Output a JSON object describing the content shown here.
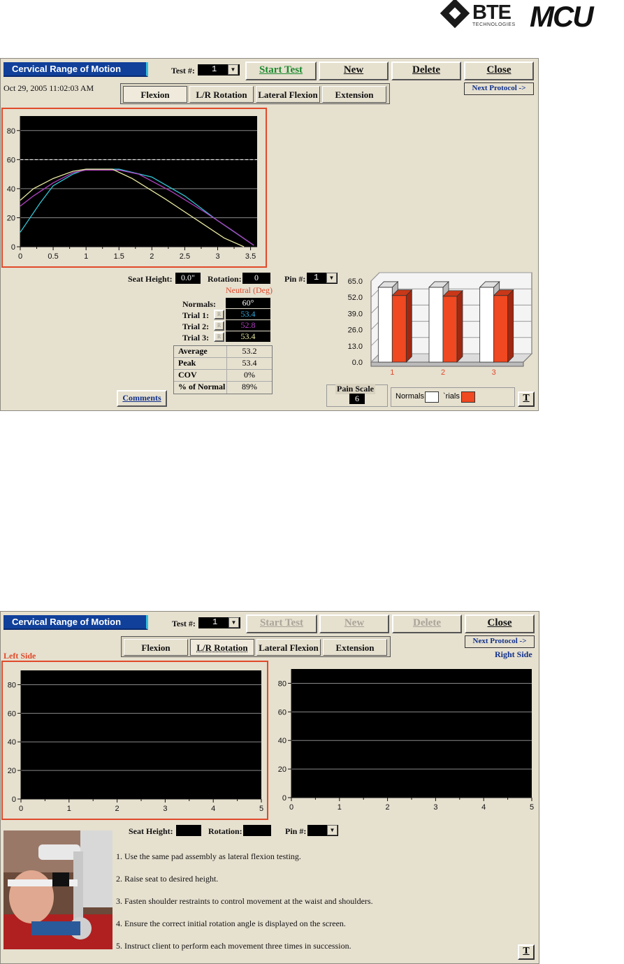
{
  "header": {
    "bte_brand": "BTE",
    "bte_sub": "TECHNOLOGIES",
    "mcu_brand": "MCU"
  },
  "colors": {
    "title_bg": "#10409a",
    "accent_red": "#e04a2a",
    "panel": "#e6e0cf",
    "plot_bg": "#000000"
  },
  "panel1": {
    "title": "Cervical Range of Motion",
    "test_label": "Test #:",
    "test_value": "1",
    "start_test": "Start Test",
    "new": "New",
    "delete": "Delete",
    "close": "Close",
    "timestamp": "Oct 29, 2005 11:02:03 AM",
    "tabs": [
      "Flexion",
      "L/R Rotation",
      "Lateral Flexion",
      "Extension"
    ],
    "next_protocol": "Next Protocol ->",
    "seat_height_label": "Seat Height:",
    "seat_height_value": "0.0\"",
    "rotation_label": "Rotation:",
    "rotation_value": "0",
    "neutral_label": "Neutral (Deg)",
    "pin_label": "Pin #:",
    "pin_value": "1",
    "normals_label": "Normals:",
    "normals_value": "60°",
    "trials": [
      {
        "label": "Trial 1:",
        "value": "53.4",
        "color": "#30a8d8"
      },
      {
        "label": "Trial 2:",
        "value": "52.8",
        "color": "#b040c0"
      },
      {
        "label": "Trial 3:",
        "value": "53.4",
        "color": "#e8e8a0"
      }
    ],
    "r_button": "R",
    "stats": [
      {
        "label": "Average",
        "value": "53.2"
      },
      {
        "label": "Peak",
        "value": "53.4"
      },
      {
        "label": "COV",
        "value": "0%"
      },
      {
        "label": "% of Normal",
        "value": "89%"
      }
    ],
    "comments": "Comments",
    "pain_scale_label": "Pain Scale",
    "pain_scale_value": "6",
    "legend_normals": "Normals",
    "legend_trials": "`rials",
    "t_button": "T"
  },
  "panel2": {
    "title": "Cervical Range of Motion",
    "test_label": "Test #:",
    "test_value": "1",
    "start_test": "Start Test",
    "new": "New",
    "delete": "Delete",
    "close": "Close",
    "tabs": [
      "Flexion",
      "L/R Rotation",
      "Lateral Flexion",
      "Extension"
    ],
    "next_protocol": "Next Protocol ->",
    "left_side": "Left Side",
    "right_side": "Right Side",
    "seat_height_label": "Seat Height:",
    "rotation_label": "Rotation:",
    "pin_label": "Pin #:",
    "instructions": [
      "1.  Use the same pad assembly as lateral flexion testing.",
      "2.  Raise seat to desired height.",
      "3.  Fasten shoulder restraints to control movement at the waist and shoulders.",
      "4.  Ensure the correct initial rotation angle is displayed on the screen.",
      "5.  Instruct client to perform each movement three times in succession."
    ],
    "t_button": "T"
  },
  "chart_data": [
    {
      "type": "line",
      "xlim": [
        0,
        3.6
      ],
      "ylim": [
        0,
        90
      ],
      "x_ticks": [
        "0",
        "0.5",
        "1",
        "1.5",
        "2",
        "2.5",
        "3",
        "3.5"
      ],
      "y_ticks": [
        "0",
        "20",
        "40",
        "60",
        "80"
      ],
      "reference_line": 60,
      "series": [
        {
          "color": "#30c8d8",
          "x": [
            0,
            0.15,
            0.3,
            0.5,
            0.8,
            1.0,
            1.5,
            2.0,
            2.5,
            3.0,
            3.55
          ],
          "y": [
            10,
            20,
            30,
            42,
            50,
            53.4,
            53.4,
            48,
            35,
            18,
            1
          ]
        },
        {
          "color": "#b040c0",
          "x": [
            0,
            0.2,
            0.5,
            0.8,
            1.0,
            1.5,
            1.8,
            2.3,
            2.8,
            3.2,
            3.55
          ],
          "y": [
            28,
            35,
            44,
            51,
            52.8,
            52.8,
            50,
            38,
            24,
            12,
            1
          ]
        },
        {
          "color": "#e8e8a0",
          "x": [
            0,
            0.2,
            0.5,
            0.8,
            1.0,
            1.4,
            1.7,
            2.2,
            2.7,
            3.1,
            3.4
          ],
          "y": [
            32,
            40,
            47,
            52,
            53.4,
            53.4,
            47,
            33,
            18,
            6,
            0
          ]
        }
      ]
    },
    {
      "type": "bar",
      "categories": [
        "1",
        "2",
        "3"
      ],
      "y_ticks": [
        "0.0",
        "13.0",
        "26.0",
        "39.0",
        "52.0",
        "65.0"
      ],
      "ylim": [
        0,
        65
      ],
      "series": [
        {
          "name": "Normals",
          "color": "#ffffff",
          "values": [
            60,
            60,
            60
          ]
        },
        {
          "name": "Trials",
          "color": "#f04820",
          "values": [
            53.4,
            52.8,
            53.4
          ]
        }
      ]
    },
    {
      "type": "line",
      "xlim": [
        0,
        5
      ],
      "ylim": [
        0,
        90
      ],
      "x_ticks": [
        "0",
        "1",
        "2",
        "3",
        "4",
        "5"
      ],
      "y_ticks": [
        "0",
        "20",
        "40",
        "60",
        "80"
      ],
      "series": []
    },
    {
      "type": "line",
      "xlim": [
        0,
        5
      ],
      "ylim": [
        0,
        90
      ],
      "x_ticks": [
        "0",
        "1",
        "2",
        "3",
        "4",
        "5"
      ],
      "y_ticks": [
        "0",
        "20",
        "40",
        "60",
        "80"
      ],
      "series": []
    }
  ]
}
